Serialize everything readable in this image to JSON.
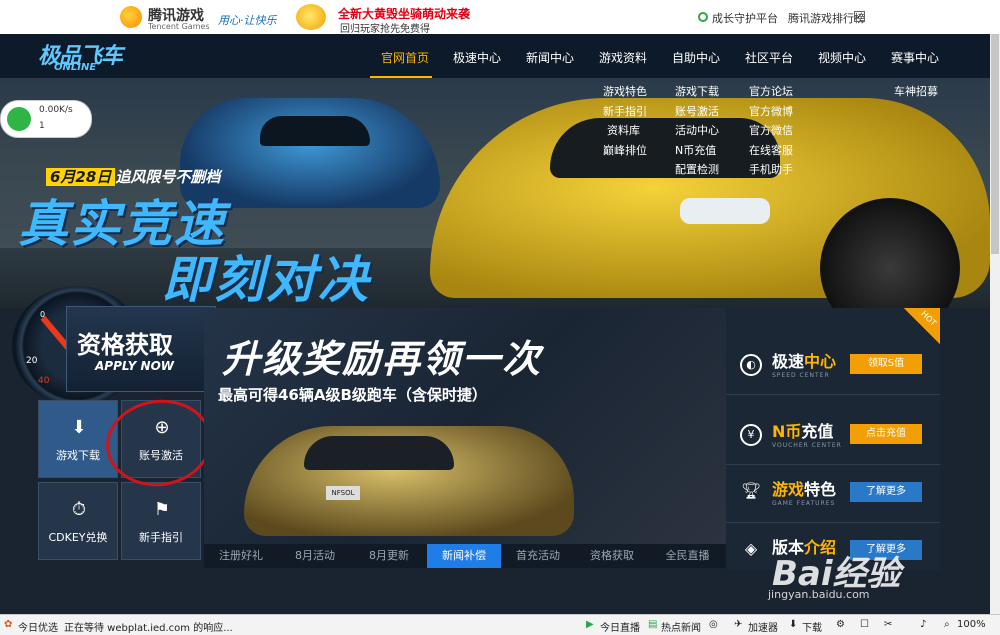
{
  "topbar": {
    "tencent_cn": "腾讯游戏",
    "tencent_en": "Tencent Games",
    "slogan": "用心·让快乐",
    "promo_title": "全新大黄毁坐骑萌动来袭",
    "promo_sub": "回归玩家抢先免费得",
    "guard": "成长守护平台",
    "ranking": "腾讯游戏排行榜"
  },
  "logo": {
    "cn": "极品飞车",
    "en": "ONLINE"
  },
  "nav": {
    "items": [
      "官网首页",
      "极速中心",
      "新闻中心",
      "游戏资料",
      "自助中心",
      "社区平台",
      "视频中心",
      "赛事中心"
    ],
    "active": "官网首页"
  },
  "submenu": {
    "col1": [
      "游戏特色",
      "新手指引",
      "资料库",
      "巅峰排位"
    ],
    "col2": [
      "游戏下载",
      "账号激活",
      "活动中心",
      "N币充值",
      "配置检测"
    ],
    "col3": [
      "官方论坛",
      "官方微博",
      "官方微信",
      "在线客服",
      "手机助手"
    ],
    "col4": [
      "车神招募"
    ]
  },
  "netwidget": {
    "speed": "0.00K/s",
    "count": "1"
  },
  "hero": {
    "date": "6月28日",
    "tagline": "追风限号不删档",
    "line1": "真实竞速",
    "line2": "即刻对决"
  },
  "gauge": {
    "n0": "0",
    "n1": "20",
    "n2": "40"
  },
  "apply": {
    "cn": "资格获取",
    "en": "APPLY NOW"
  },
  "tiles": [
    {
      "label": "游戏下载",
      "icon": "download-icon"
    },
    {
      "label": "账号激活",
      "icon": "skull-target-icon"
    },
    {
      "label": "CDKEY兑换",
      "icon": "stopwatch-icon"
    },
    {
      "label": "新手指引",
      "icon": "flag-icon"
    }
  ],
  "banner": {
    "title": "升级奖励再领一次",
    "subtitle": "最高可得46辆A级B级跑车（含保时捷）",
    "plate": "NFSOL"
  },
  "banner_tabs": [
    "注册好礼",
    "8月活动",
    "8月更新",
    "新闻补偿",
    "首充活动",
    "资格获取",
    "全民直播"
  ],
  "banner_tab_active": "新闻补偿",
  "right_panel": [
    {
      "title_a": "极速",
      "title_b": "中心",
      "sub": "SPEED CENTER",
      "btn": "领取S值",
      "btn_color": "#f29f05"
    },
    {
      "title_a": "N币",
      "title_b": "充值",
      "sub": "VOUCHER CENTER",
      "btn": "点击充值",
      "btn_color": "#f29f05"
    },
    {
      "title_a": "游戏",
      "title_b": "特色",
      "sub": "GAME FEATURES",
      "btn": "了解更多",
      "btn_color": "#2a79c9"
    },
    {
      "title_a": "版本",
      "title_b": "介绍",
      "sub": "",
      "btn": "了解更多",
      "btn_color": "#2a79c9"
    }
  ],
  "hot": "HOT",
  "watermark": {
    "logo": "Bai经验",
    "url": "jingyan.baidu.com"
  },
  "status": {
    "left1": "今日优选",
    "left2": "正在等待 webplat.ied.com 的响应...",
    "live": "今日直播",
    "hot_news": "热点新闻",
    "accelerator": "加速器",
    "download": "下载",
    "zoom": "100%"
  }
}
